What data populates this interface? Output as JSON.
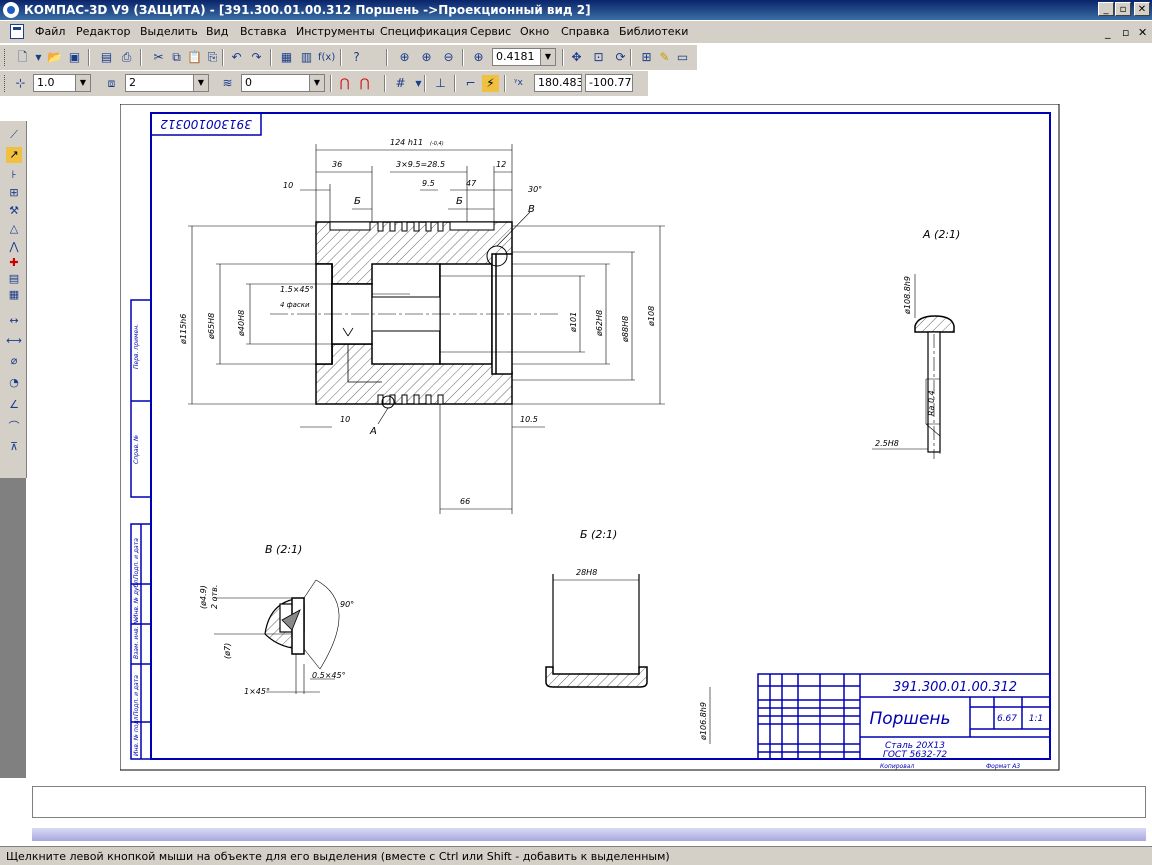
{
  "window": {
    "title": "КОМПАС-3D V9 (ЗАЩИТА) - [391.300.01.00.312 Поршень ->Проекционный вид 2]",
    "controls": [
      "_",
      "▫",
      "✕"
    ]
  },
  "menu": {
    "items": [
      "Файл",
      "Редактор",
      "Выделить",
      "Вид",
      "Вставка",
      "Инструменты",
      "Спецификация",
      "Сервис",
      "Окно",
      "Справка",
      "Библиотеки"
    ],
    "mdi_controls": [
      "_",
      "▫",
      "✕"
    ]
  },
  "toolbar_standard": {
    "zoom_value": "0.4181"
  },
  "toolbar_current_state": {
    "step_value": "1.0",
    "layer_value": "2",
    "style_value": "0",
    "coord_x": "180.483",
    "coord_y": "-100.77"
  },
  "drawing": {
    "stamp_code_rotated": "391300100312",
    "main_view": {
      "dim_total_length": "124 h11",
      "dim_total_length_tol": "(-0,4)",
      "dim_36": "36",
      "dim_grooves": "3×9.5=28.5",
      "dim_12": "12",
      "dim_9_5": "9.5",
      "dim_47": "47",
      "dim_10_top": "10",
      "dim_30deg": "30°",
      "dim_d115": "ø115h6",
      "dim_d65": "ø65H8",
      "dim_d40": "ø40H8",
      "dim_chamfer": "1.5×45°",
      "dim_chamfer_note": "4 фаски",
      "dim_d101": "ø101",
      "dim_d62": "ø62H8",
      "dim_d88": "ø88H8",
      "dim_d108": "ø108",
      "dim_10_bottom": "10",
      "dim_10_5": "10.5",
      "dim_66": "66",
      "label_b_left": "Б",
      "label_b_right": "Б",
      "label_v": "В",
      "label_a": "А"
    },
    "view_a": {
      "title": "А (2:1)",
      "dim_d108": "ø108.8h9",
      "roughness": "Ra 0.4",
      "dim_2_5": "2.5H8"
    },
    "view_v": {
      "title": "В (2:1)",
      "dim_angle": "90°",
      "dim_4_9": "(ø4.9)",
      "dim_2otv": "2 отв.",
      "dim_7": "(ø7)",
      "dim_chamfer1": "0.5×45°",
      "dim_chamfer2": "1×45°"
    },
    "view_b": {
      "title": "Б (2:1)",
      "dim_28": "28H8",
      "dim_d106": "ø106.8h9"
    },
    "title_block": {
      "code": "391.300.01.00.312",
      "part_name": "Поршень",
      "material_line1": "Сталь 20Х13",
      "material_line2": "ГОСТ 5632-72",
      "mass": "6.67",
      "scale": "1:1",
      "copied": "Копировал",
      "format": "Формат А3"
    },
    "side_labels": [
      "Перв. примен.",
      "Справ. №",
      "Подп. и дата",
      "Инв. № дубл.",
      "Взам. инв. №",
      "Подп. и дата",
      "Инв. № подл."
    ]
  },
  "status": {
    "text": "Щелкните левой кнопкой мыши на объекте для его выделения (вместе с Ctrl или Shift - добавить к выделенным)"
  },
  "colors": {
    "frame_blue": "#0000b4",
    "title_bar": "#0a246a",
    "toolbar_bg": "#d4d0c8"
  }
}
